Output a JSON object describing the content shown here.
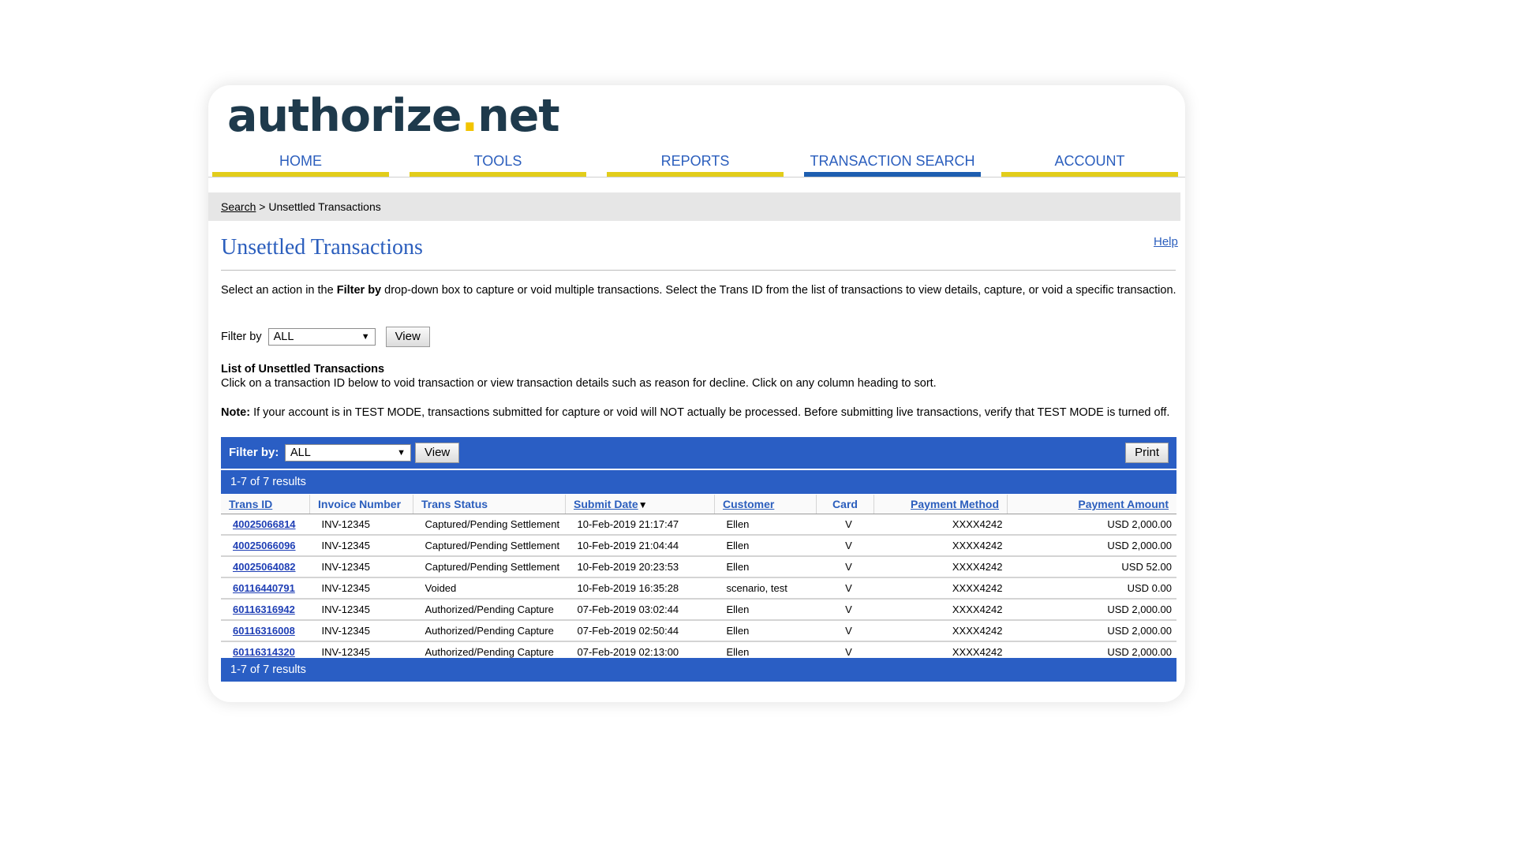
{
  "logo": {
    "part1": "authorize",
    "dot": ".",
    "part2": "net"
  },
  "nav": [
    {
      "label": "HOME",
      "active": false
    },
    {
      "label": "TOOLS",
      "active": false
    },
    {
      "label": "REPORTS",
      "active": false
    },
    {
      "label": "TRANSACTION SEARCH",
      "active": true
    },
    {
      "label": "ACCOUNT",
      "active": false
    }
  ],
  "breadcrumb": {
    "link": "Search",
    "separator": ">",
    "current": "Unsettled Transactions"
  },
  "page": {
    "title": "Unsettled Transactions",
    "help": "Help"
  },
  "intro": {
    "pre": "Select an action in the ",
    "bold": "Filter by",
    "post": " drop-down box to capture or void multiple transactions. Select the Trans ID from the list of transactions to view details, capture, or void a specific transaction."
  },
  "filter_top": {
    "label": "Filter by",
    "value": "ALL",
    "button": "View"
  },
  "list": {
    "heading": "List of Unsettled Transactions",
    "text": "Click on a transaction ID below to void transaction or view transaction details such as reason for decline. Click on any column heading to sort."
  },
  "note": {
    "label": "Note:",
    "text": " If your account is in TEST MODE, transactions submitted for capture or void will NOT actually be processed. Before submitting live transactions, verify that TEST MODE is turned off."
  },
  "table_bar": {
    "filter_label": "Filter by:",
    "filter_value": "ALL",
    "view_button": "View",
    "print_button": "Print"
  },
  "results_text": "1-7 of 7 results",
  "columns": {
    "trans_id": "Trans ID",
    "invoice": "Invoice Number",
    "status": "Trans Status",
    "submit_date": "Submit Date",
    "customer": "Customer",
    "card": "Card",
    "payment_method": "Payment Method",
    "payment_amount": "Payment Amount"
  },
  "rows": [
    {
      "id": "40025066814",
      "invoice": "INV-12345",
      "status": "Captured/Pending Settlement",
      "date": "10-Feb-2019 21:17:47",
      "customer": "Ellen",
      "card": "V",
      "method": "XXXX4242",
      "amount": "USD 2,000.00"
    },
    {
      "id": "40025066096",
      "invoice": "INV-12345",
      "status": "Captured/Pending Settlement",
      "date": "10-Feb-2019 21:04:44",
      "customer": "Ellen",
      "card": "V",
      "method": "XXXX4242",
      "amount": "USD 2,000.00"
    },
    {
      "id": "40025064082",
      "invoice": "INV-12345",
      "status": "Captured/Pending Settlement",
      "date": "10-Feb-2019 20:23:53",
      "customer": "Ellen",
      "card": "V",
      "method": "XXXX4242",
      "amount": "USD 52.00"
    },
    {
      "id": "60116440791",
      "invoice": "INV-12345",
      "status": "Voided",
      "date": "10-Feb-2019 16:35:28",
      "customer": "scenario, test",
      "card": "V",
      "method": "XXXX4242",
      "amount": "USD 0.00"
    },
    {
      "id": "60116316942",
      "invoice": "INV-12345",
      "status": "Authorized/Pending Capture",
      "date": "07-Feb-2019 03:02:44",
      "customer": "Ellen",
      "card": "V",
      "method": "XXXX4242",
      "amount": "USD 2,000.00"
    },
    {
      "id": "60116316008",
      "invoice": "INV-12345",
      "status": "Authorized/Pending Capture",
      "date": "07-Feb-2019 02:50:44",
      "customer": "Ellen",
      "card": "V",
      "method": "XXXX4242",
      "amount": "USD 2,000.00"
    },
    {
      "id": "60116314320",
      "invoice": "INV-12345",
      "status": "Authorized/Pending Capture",
      "date": "07-Feb-2019 02:13:00",
      "customer": "Ellen",
      "card": "V",
      "method": "XXXX4242",
      "amount": "USD 2,000.00"
    }
  ]
}
